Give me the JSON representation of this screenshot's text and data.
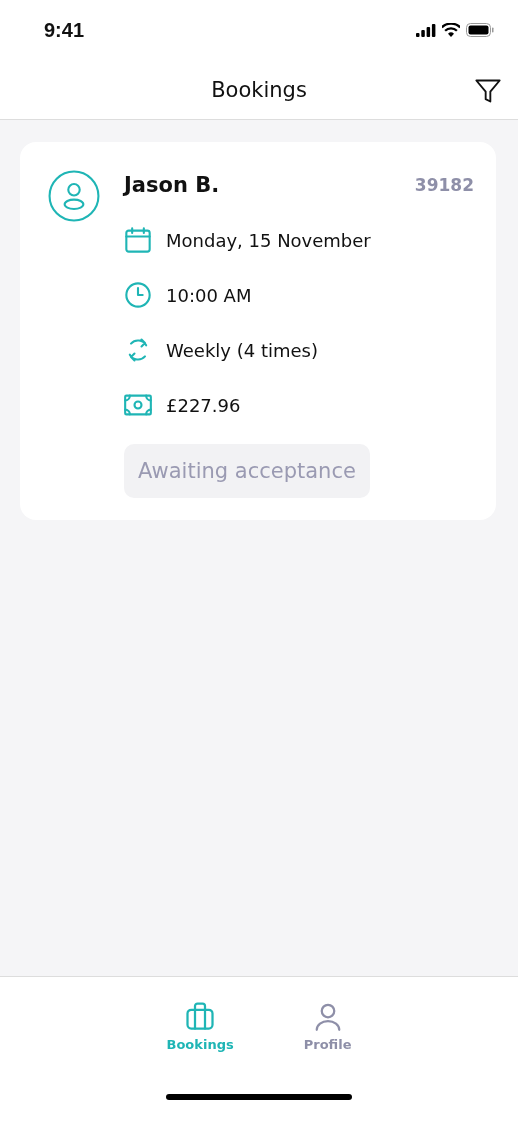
{
  "status_bar": {
    "time": "9:41"
  },
  "header": {
    "title": "Bookings"
  },
  "bookings": [
    {
      "customer": "Jason B.",
      "reference": "39182",
      "details": [
        {
          "kind": "date",
          "text": "Monday, 15 November"
        },
        {
          "kind": "time",
          "text": "10:00 AM"
        },
        {
          "kind": "repeat",
          "text": "Weekly (4 times)"
        },
        {
          "kind": "price",
          "text": "£227.96"
        }
      ],
      "status": "Awaiting acceptance"
    }
  ],
  "tab_bar": [
    {
      "label": "Bookings",
      "kind": "bookings",
      "selected": true
    },
    {
      "label": "Profile",
      "kind": "profile",
      "selected": false
    }
  ]
}
